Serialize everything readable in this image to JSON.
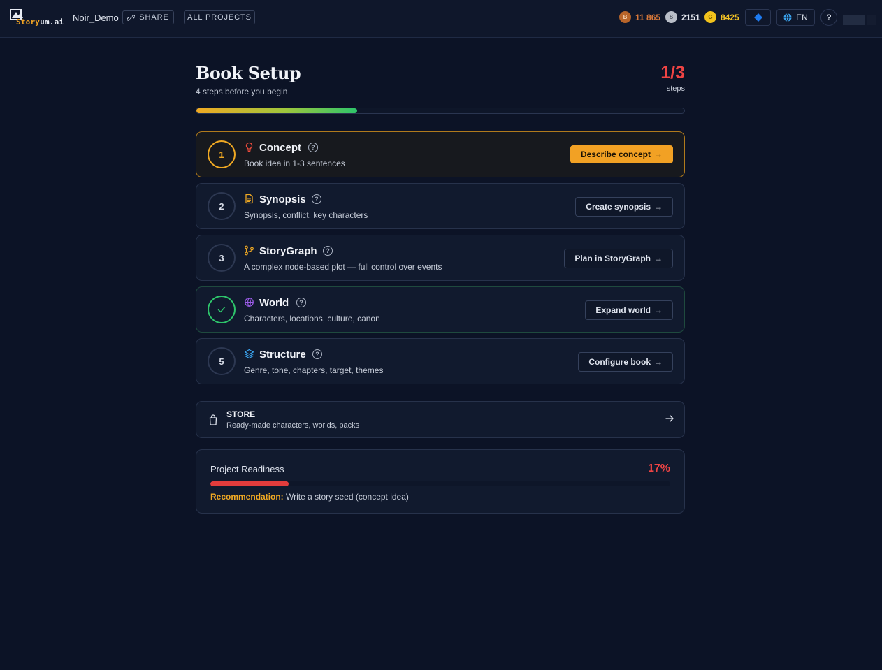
{
  "header": {
    "logo_part1": "Story",
    "logo_part2": "um.ai",
    "project_name": "Noir_Demo",
    "share_label": "SHARE",
    "all_projects_label": "ALL PROJECTS",
    "currencies": [
      {
        "letter": "B",
        "value": "11 865"
      },
      {
        "letter": "S",
        "value": "2151"
      },
      {
        "letter": "G",
        "value": "8425"
      }
    ],
    "language": "EN",
    "help": "?"
  },
  "setup": {
    "title": "Book Setup",
    "subtitle": "4 steps before you begin",
    "steps_count": "1/3",
    "steps_unit": "steps",
    "progress": 0.33,
    "items": [
      {
        "number": "1",
        "title": "Concept",
        "description": "Book idea in 1-3 sentences",
        "button": "Describe concept",
        "icon": "lightbulb-icon",
        "state": "active"
      },
      {
        "number": "2",
        "title": "Synopsis",
        "description": "Synopsis, conflict, key characters",
        "button": "Create synopsis",
        "icon": "document-icon",
        "state": "todo"
      },
      {
        "number": "3",
        "title": "StoryGraph",
        "description": "A complex node-based plot — full control over events",
        "button": "Plan in StoryGraph",
        "icon": "branch-icon",
        "state": "todo"
      },
      {
        "number": "",
        "title": "World",
        "description": "Characters, locations, culture, canon",
        "button": "Expand world",
        "icon": "globe-icon",
        "state": "done"
      },
      {
        "number": "5",
        "title": "Structure",
        "description": "Genre, tone, chapters, target, themes",
        "button": "Configure book",
        "icon": "layers-icon",
        "state": "todo"
      }
    ]
  },
  "store": {
    "title": "STORE",
    "description": "Ready-made characters, worlds, packs"
  },
  "readiness": {
    "title": "Project Readiness",
    "percent_label": "17%",
    "percent": 0.17,
    "recommendation_label": "Recommendation:",
    "recommendation_text": "Write a story seed (concept idea)"
  },
  "colors": {
    "accent": "#f2a124",
    "danger": "#ef4444",
    "success": "#2ec56b",
    "background": "#0c1326"
  }
}
